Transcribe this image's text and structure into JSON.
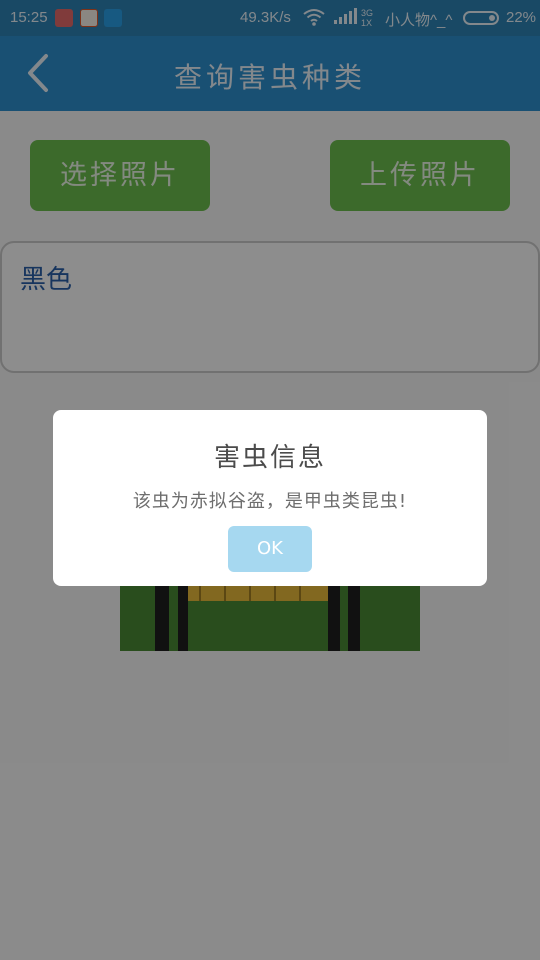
{
  "status_bar": {
    "time": "15:25",
    "net_speed": "49.3K/s",
    "net_type_top": "3G",
    "net_type_bottom": "1X",
    "carrier": "小人物^_^",
    "battery_percent": "22%",
    "battery_level": 0.22
  },
  "header": {
    "title": "查询害虫种类",
    "back_icon": "chevron-left-icon"
  },
  "buttons": {
    "select_photo": "选择照片",
    "upload_photo": "上传照片"
  },
  "result": {
    "text": "黑色"
  },
  "dialog": {
    "title": "害虫信息",
    "message": "该虫为赤拟谷盗，是甲虫类昆虫!",
    "ok_label": "OK"
  },
  "colors": {
    "status_bar": "#2d83b5",
    "app_bar": "#2d8fcd",
    "button_green": "#6cbd4d",
    "ok_button": "#a6d8f0",
    "result_text": "#2a5fa8"
  }
}
